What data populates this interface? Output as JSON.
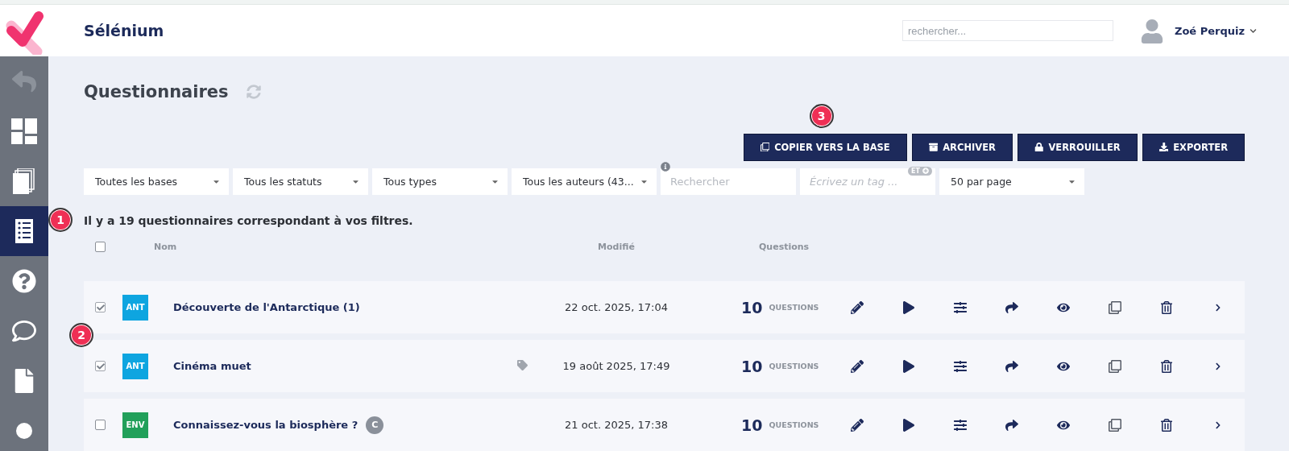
{
  "header": {
    "title": "Sélénium",
    "search": {
      "placeholder": "rechercher..."
    },
    "user": "Zoé Perquiz"
  },
  "sidebar": {
    "items": [
      {
        "selected": false,
        "disabled": true
      },
      {
        "selected": false,
        "disabled": false
      },
      {
        "selected": false,
        "disabled": false
      },
      {
        "selected": true,
        "disabled": false,
        "callout": "1"
      },
      {
        "selected": false,
        "disabled": false
      },
      {
        "selected": false,
        "disabled": false
      },
      {
        "selected": false,
        "disabled": false
      },
      {
        "selected": false,
        "disabled": false
      }
    ]
  },
  "page": {
    "title": "Questionnaires"
  },
  "actions": [
    {
      "label": "COPIER VERS LA BASE",
      "callout": "3"
    },
    {
      "label": "ARCHIVER"
    },
    {
      "label": "VERROUILLER"
    },
    {
      "label": "EXPORTER"
    }
  ],
  "filters": [
    {
      "kind": "select",
      "value": "Toutes les bases"
    },
    {
      "kind": "select",
      "value": "Tous les statuts"
    },
    {
      "kind": "select",
      "value": "Tous types"
    },
    {
      "kind": "select",
      "value": "Tous les auteurs (43..."
    },
    {
      "kind": "search",
      "placeholder": "Rechercher"
    },
    {
      "kind": "tag",
      "placeholder": "Écrivez un tag ...",
      "toggle": "ET"
    },
    {
      "kind": "select",
      "value": "50 par page"
    }
  ],
  "summary": "Il y a 19 questionnaires correspondant à vos filtres.",
  "table": {
    "select_all": {
      "checked": false
    },
    "columns": [
      "Nom",
      "Modifié",
      "Questions"
    ],
    "rows": [
      {
        "checked": true,
        "code": "ANT",
        "color": "#0ea5e0",
        "name": "Découverte de l'Antarctique (1)",
        "tagged": false,
        "date": "22 oct. 2025, 17:04",
        "count": "10",
        "unit": "QUESTIONS"
      },
      {
        "checked": true,
        "code": "ANT",
        "color": "#0ea5e0",
        "name": "Cinéma muet",
        "tagged": true,
        "date": "19 août 2025, 17:49",
        "count": "10",
        "unit": "QUESTIONS",
        "callout": "2"
      },
      {
        "checked": false,
        "code": "ENV",
        "color": "#22a05a",
        "name": "Connaissez-vous la biosphère ?",
        "badge": "C",
        "tagged": false,
        "date": "21 oct. 2025, 17:38",
        "count": "10",
        "unit": "QUESTIONS"
      }
    ]
  }
}
